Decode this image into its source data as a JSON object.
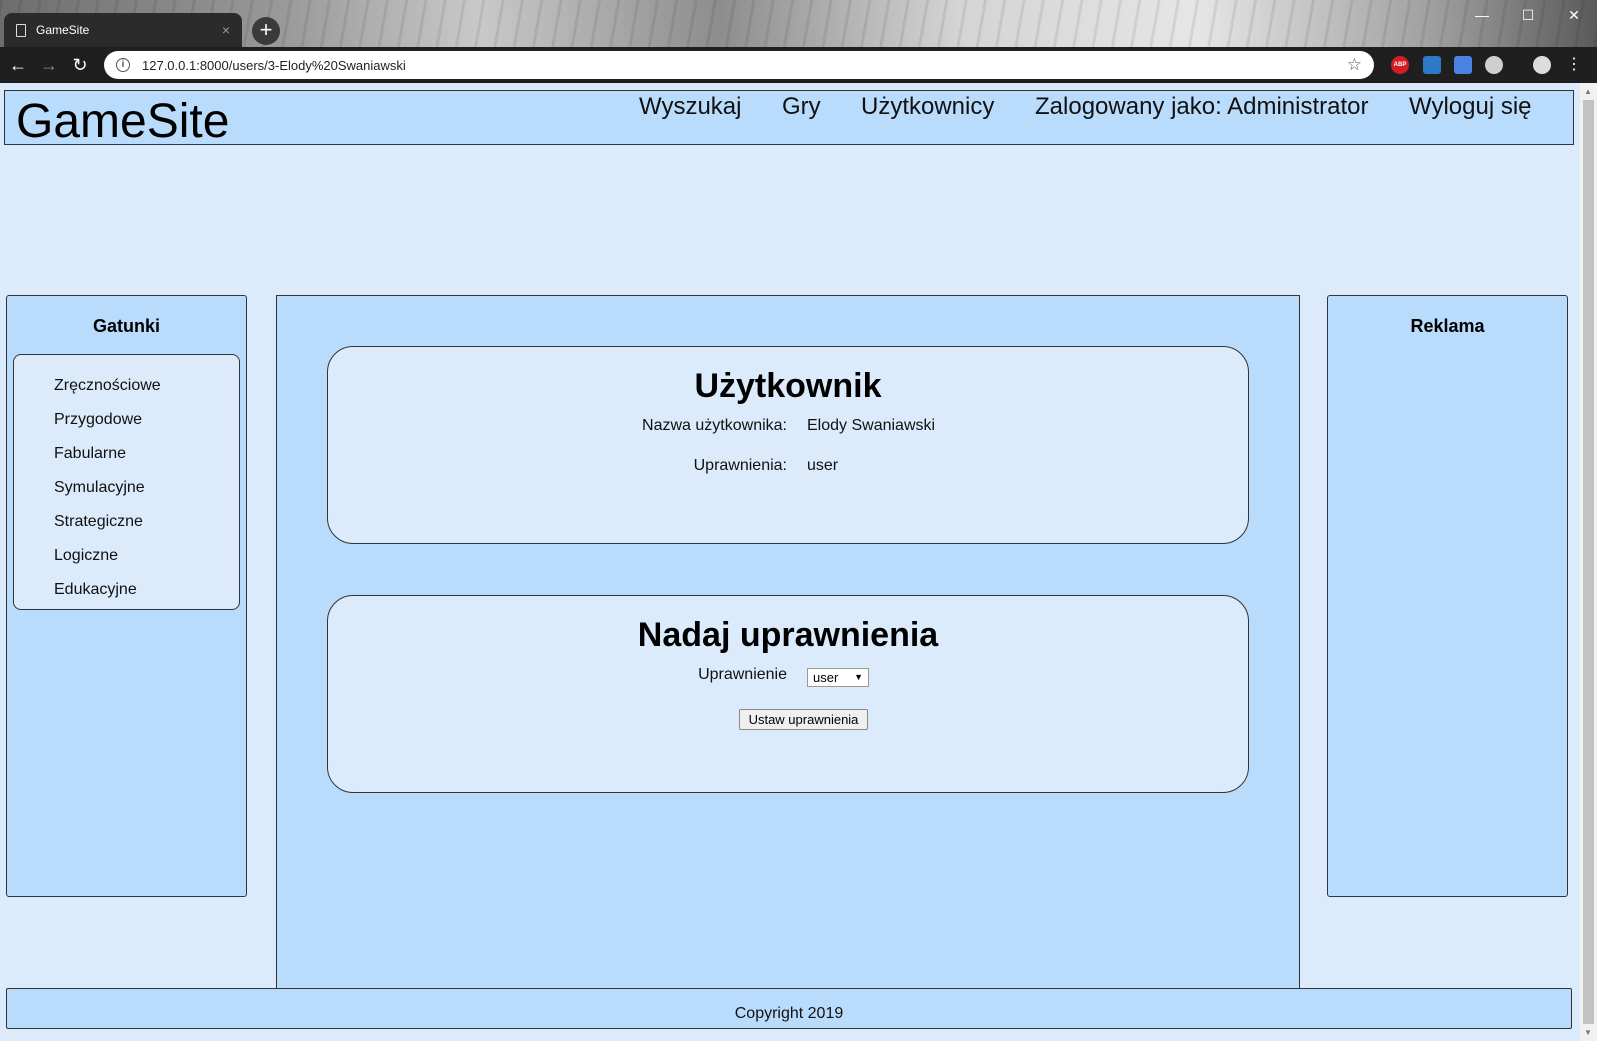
{
  "browser": {
    "tab_title": "GameSite",
    "url": "127.0.0.1:8000/users/3-Elody%20Swaniawski",
    "new_tab_label": "+",
    "close_tab": "×"
  },
  "header": {
    "logo": "GameSite",
    "nav": {
      "search": "Wyszukaj",
      "games": "Gry",
      "users": "Użytkownicy",
      "logged_in": "Zalogowany jako: Administrator",
      "logout": "Wyloguj się"
    }
  },
  "sidebar_left": {
    "title": "Gatunki",
    "genres": [
      "Zręcznościowe",
      "Przygodowe",
      "Fabularne",
      "Symulacyjne",
      "Strategiczne",
      "Logiczne",
      "Edukacyjne"
    ]
  },
  "sidebar_right": {
    "title": "Reklama"
  },
  "user_card": {
    "title": "Użytkownik",
    "username_label": "Nazwa użytkownika:",
    "username_value": "Elody Swaniawski",
    "role_label": "Uprawnienia:",
    "role_value": "user"
  },
  "permission_card": {
    "title": "Nadaj uprawnienia",
    "select_label": "Uprawnienie",
    "select_value": "user",
    "submit_label": "Ustaw uprawnienia"
  },
  "footer": {
    "text": "Copyright 2019"
  }
}
